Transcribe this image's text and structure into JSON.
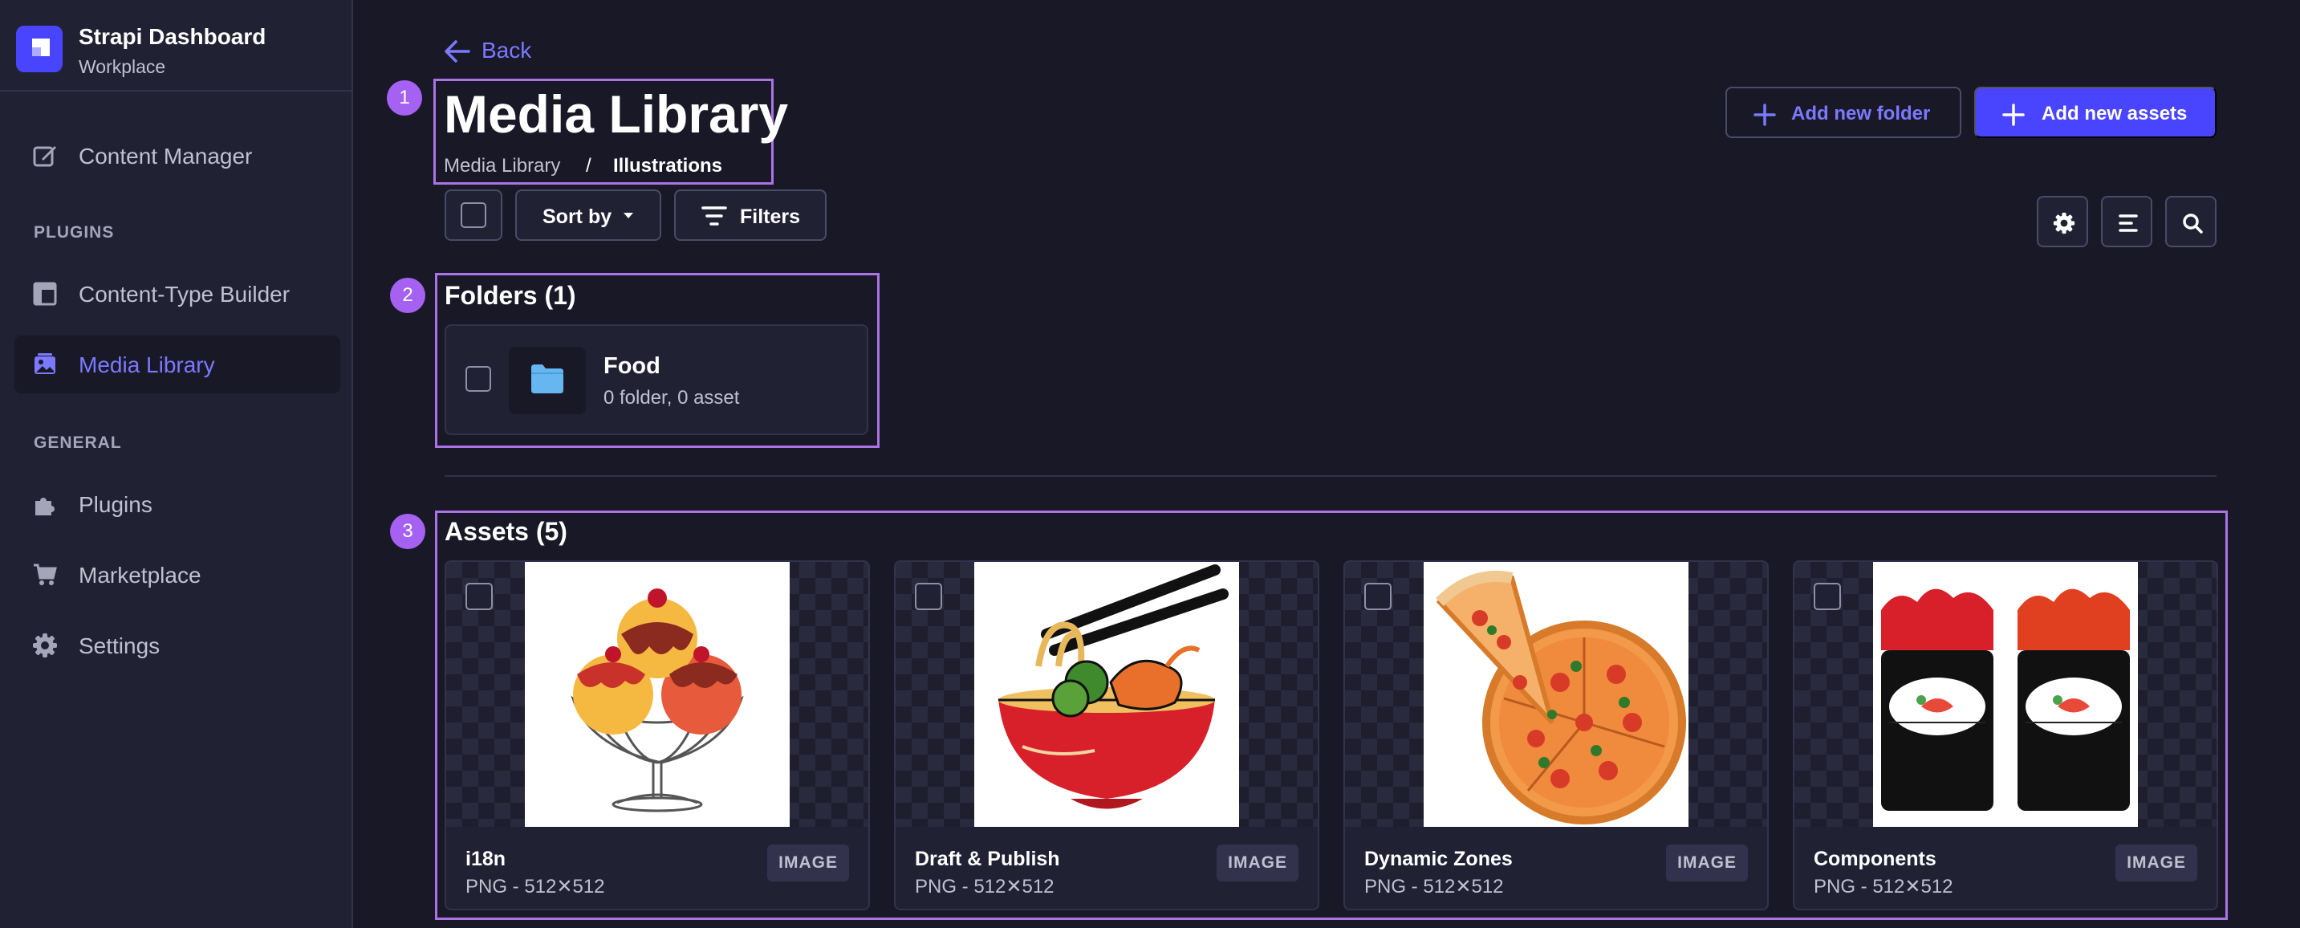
{
  "sidebar": {
    "brand": {
      "title": "Strapi Dashboard",
      "subtitle": "Workplace"
    },
    "items": [
      {
        "label": "Content Manager",
        "icon": "feather-icon",
        "active": false
      },
      {
        "label": "Content-Type Builder",
        "icon": "layout-icon",
        "active": false
      },
      {
        "label": "Media Library",
        "icon": "picture-icon",
        "active": true
      },
      {
        "label": "Plugins",
        "icon": "puzzle-icon",
        "active": false
      },
      {
        "label": "Marketplace",
        "icon": "cart-icon",
        "active": false
      },
      {
        "label": "Settings",
        "icon": "gear-icon",
        "active": false
      }
    ],
    "sections": {
      "plugins": "PLUGINS",
      "general": "GENERAL"
    }
  },
  "header": {
    "back_label": "Back",
    "title": "Media Library",
    "breadcrumb": [
      "Media Library",
      "/",
      "Illustrations"
    ],
    "add_folder_label": "Add new folder",
    "add_assets_label": "Add new assets"
  },
  "toolbar": {
    "sort_label": "Sort by",
    "filters_label": "Filters",
    "icons": [
      "gear-icon",
      "list-icon",
      "search-icon"
    ]
  },
  "annotations": [
    "1",
    "2",
    "3"
  ],
  "folders": {
    "heading": "Folders (1)",
    "items": [
      {
        "name": "Food",
        "meta": "0 folder, 0 asset"
      }
    ]
  },
  "assets": {
    "heading": "Assets (5)",
    "items": [
      {
        "name": "i18n",
        "meta": "PNG - 512✕512",
        "type": "IMAGE"
      },
      {
        "name": "Draft & Publish",
        "meta": "PNG - 512✕512",
        "type": "IMAGE"
      },
      {
        "name": "Dynamic Zones",
        "meta": "PNG - 512✕512",
        "type": "IMAGE"
      },
      {
        "name": "Components",
        "meta": "PNG - 512✕512",
        "type": "IMAGE"
      }
    ]
  },
  "colors": {
    "accent": "#4945ff",
    "link": "#7b79ff",
    "annotation": "#a561f2",
    "background": "#181826",
    "panel": "#212134"
  }
}
